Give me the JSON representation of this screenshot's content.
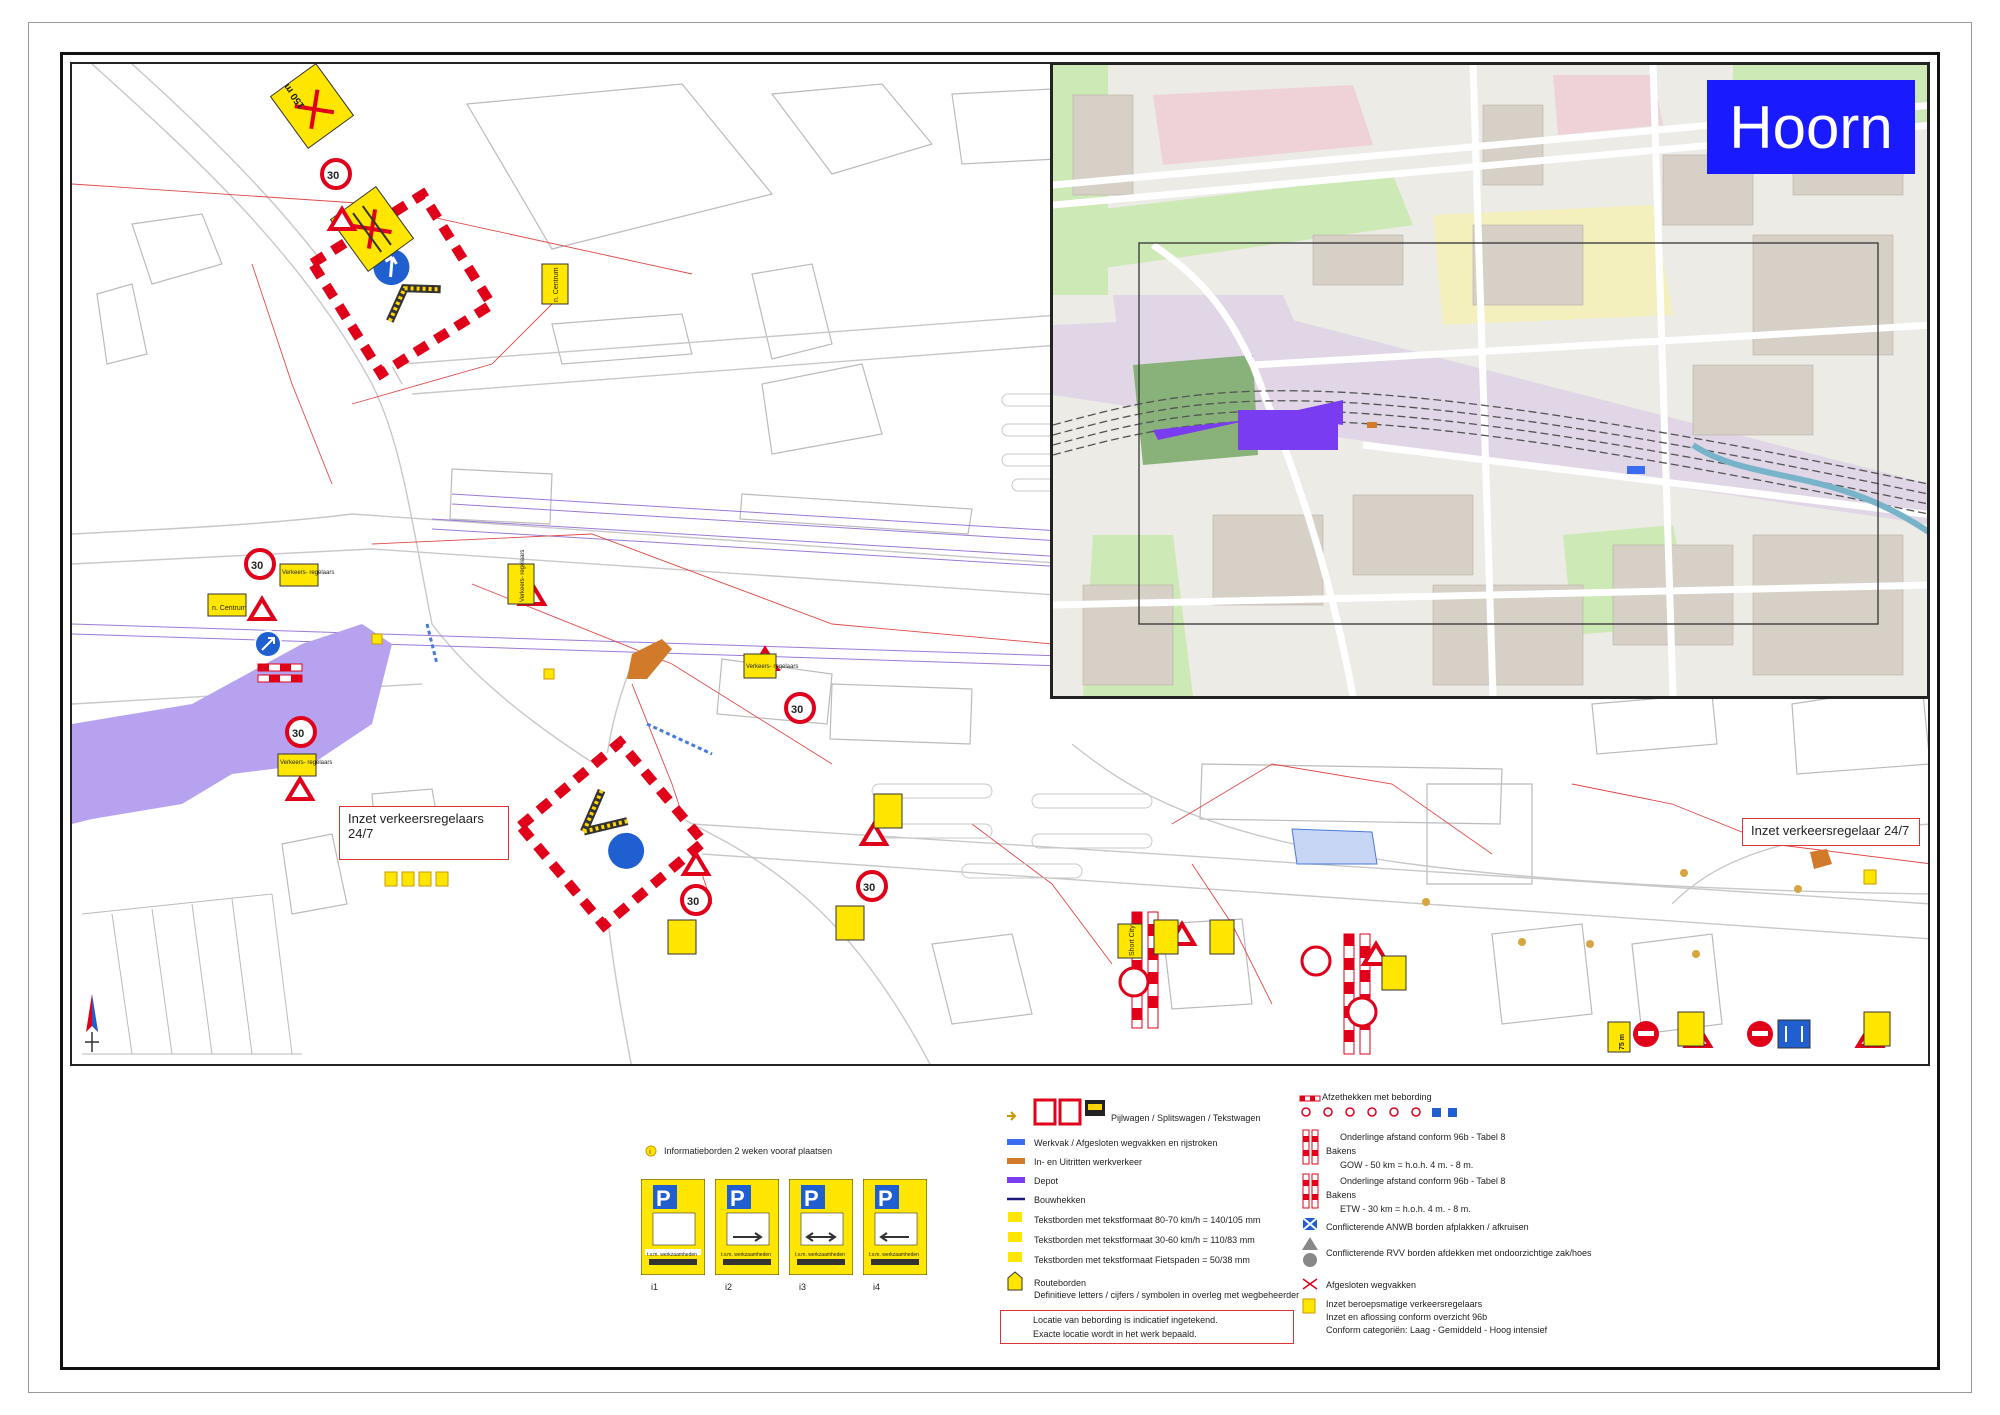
{
  "map": {
    "title": "Hoorn",
    "callouts": {
      "left": "Inzet verkeersregelaars 24/7",
      "right": "Inzet verkeersregelaar 24/7"
    },
    "signs": {
      "distance_top": "150 m",
      "speed": "30",
      "centrum": "n. Centrum",
      "verkeersregelaars": "Verkeers- regelaars",
      "short_city": "Short City",
      "distance_bottom": "75 m"
    }
  },
  "colors": {
    "depot": "#b7a2f0",
    "inset_depot": "#7a3cf0",
    "title_bg": "#1a1aff",
    "sign_yellow": "#ffe600",
    "sign_red": "#e0001a",
    "sign_blue": "#1f5fcf",
    "roads": "#c8c8c8",
    "cables": "#e04848",
    "rail": "#9a7ad8"
  },
  "legend": {
    "info_note": "Informatieborden 2 weken vooraf plaatsen",
    "parking_labels": [
      "i1",
      "i2",
      "i3",
      "i4"
    ],
    "parking_sign_bottom": "t.v.m. werkzaamheden",
    "vehicles": "Pijlwagen / Splitswagen / Tekstwagen",
    "werkvak": "Werkvak / Afgesloten wegvakken en rijstroken",
    "in_uitritten": "In- en Uitritten werkverkeer",
    "depot": "Depot",
    "bouwhekken": "Bouwhekken",
    "tekst1": "Tekstborden met tekstformaat   80-70 km/h     = 140/105  mm",
    "tekst2": "Tekstborden met tekstformaat   30-60 km/h     = 110/83    mm",
    "tekst3": "Tekstborden met tekstformaat   Fietspaden      = 50/38      mm",
    "routeborden": "Routeborden",
    "routeborden_sub": "Definitieve letters / cijfers / symbolen in overleg met wegbeheerder",
    "locatie1": "Locatie van bebording is indicatief ingetekend.",
    "locatie2": "Exacte locatie wordt in het werk bepaald.",
    "afzethekken": "Afzethekken met bebording",
    "onderlinge1": "Onderlinge afstand conform 96b - Tabel 8",
    "bakens": "Bakens",
    "gow": "GOW - 50 km = h.o.h. 4 m. - 8 m.",
    "onderlinge2": "Onderlinge afstand conform 96b - Tabel 8",
    "bakens2": "Bakens",
    "etw": "ETW - 30 km = h.o.h. 4 m. - 8 m.",
    "anwb": "Conflicterende ANWB borden afplakken / afkruisen",
    "rvv": "Conflicterende RVV borden afdekken met ondoorzichtige zak/hoes",
    "afgesloten": "Afgesloten wegvakken",
    "inzet1": "Inzet beroepsmatige verkeersregelaars",
    "inzet2": "Inzet en aflossing conform overzicht 96b",
    "inzet3": "Conform categoriën: Laag - Gemiddeld - Hoog intensief"
  }
}
